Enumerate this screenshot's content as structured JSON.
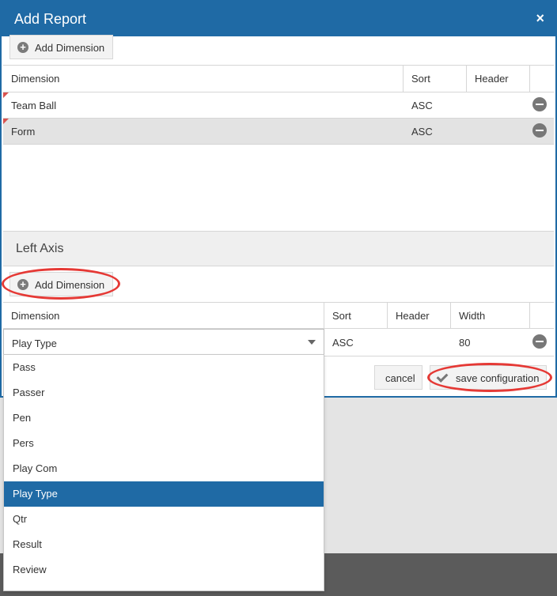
{
  "modal": {
    "title": "Add Report",
    "close_symbol": "×"
  },
  "top_section": {
    "add_dimension_label": "Add Dimension",
    "columns": [
      "Dimension",
      "Sort",
      "Header"
    ],
    "rows": [
      {
        "dimension": "Team Ball",
        "sort": "ASC"
      },
      {
        "dimension": "Form",
        "sort": "ASC"
      }
    ]
  },
  "left_axis": {
    "title": "Left Axis",
    "add_dimension_label": "Add Dimension",
    "columns": [
      "Dimension",
      "Sort",
      "Header",
      "Width"
    ],
    "row": {
      "dimension": "Play Type",
      "sort": "ASC",
      "width": "80"
    }
  },
  "footer": {
    "cancel_label": "cancel",
    "save_label": "save configuration"
  },
  "dropdown": {
    "options": [
      "Pass",
      "Passer",
      "Pen",
      "Pers",
      "Play Com",
      "Play Type",
      "Qtr",
      "Result",
      "Review"
    ],
    "selected": "Play Type"
  },
  "icons": {
    "add": "plus-circle-icon",
    "remove": "minus-circle-icon",
    "caret": "caret-down-icon",
    "check": "check-icon"
  },
  "colors": {
    "header_blue": "#1f6aa5",
    "highlight_red": "#e53935",
    "row_selected_gray": "#e3e3e3"
  }
}
